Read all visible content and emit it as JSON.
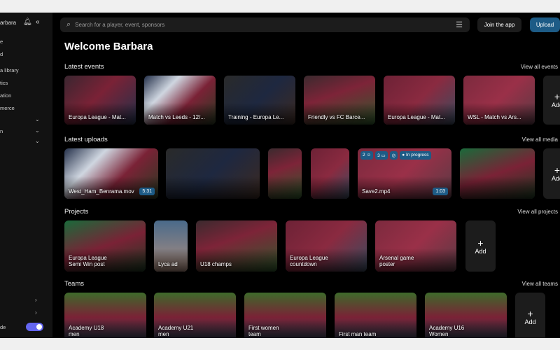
{
  "sidebar": {
    "user": "arbara",
    "items": [
      "e",
      "d",
      "a library",
      "tics",
      "ation",
      "merce",
      "",
      "n",
      ""
    ],
    "bottom_label": "de"
  },
  "topbar": {
    "search_placeholder": "Search for a player, event, sponsors",
    "join": "Join the app",
    "upload": "Upload"
  },
  "title": "Welcome Barbara",
  "events": {
    "title": "Latest events",
    "view_all": "View all events",
    "add": "Add",
    "items": [
      "Europa League - Mat...",
      "Match vs Leeds - 12/...",
      "Training - Europa Le...",
      "Friendly vs FC Barce...",
      "Europa League - Mat...",
      "WSL - Match vs Ars..."
    ]
  },
  "uploads": {
    "title": "Latest uploads",
    "view_all": "View all media",
    "add": "Add",
    "items": [
      {
        "name": "West_Ham_Benrama.mov",
        "duration": "5:31"
      },
      {
        "name": "",
        "duration": ""
      },
      {
        "name": "",
        "duration": ""
      },
      {
        "name": "",
        "duration": ""
      },
      {
        "name": "Save2.mp4",
        "duration": "1:03",
        "badges": [
          "2 ☺",
          "3 ▭",
          "◎",
          "● In progress"
        ]
      },
      {
        "name": "",
        "duration": ""
      }
    ]
  },
  "projects": {
    "title": "Projects",
    "view_all": "View all projects",
    "add": "Add",
    "items": [
      "Europa League\nSemi Win post",
      "Lyca ad",
      "U18 champs",
      "Europa League\ncountdown",
      "Arsenal game\nposter"
    ]
  },
  "teams": {
    "title": "Teams",
    "view_all": "View all teams",
    "add": "Add",
    "items": [
      "Academy U18\nmen",
      "Academy U21\nmen",
      "First women\nteam",
      "First man team",
      "Academy U16\nWomen"
    ]
  },
  "colors": {
    "accent": "#1d5b86",
    "toggle": "#6466f1"
  }
}
